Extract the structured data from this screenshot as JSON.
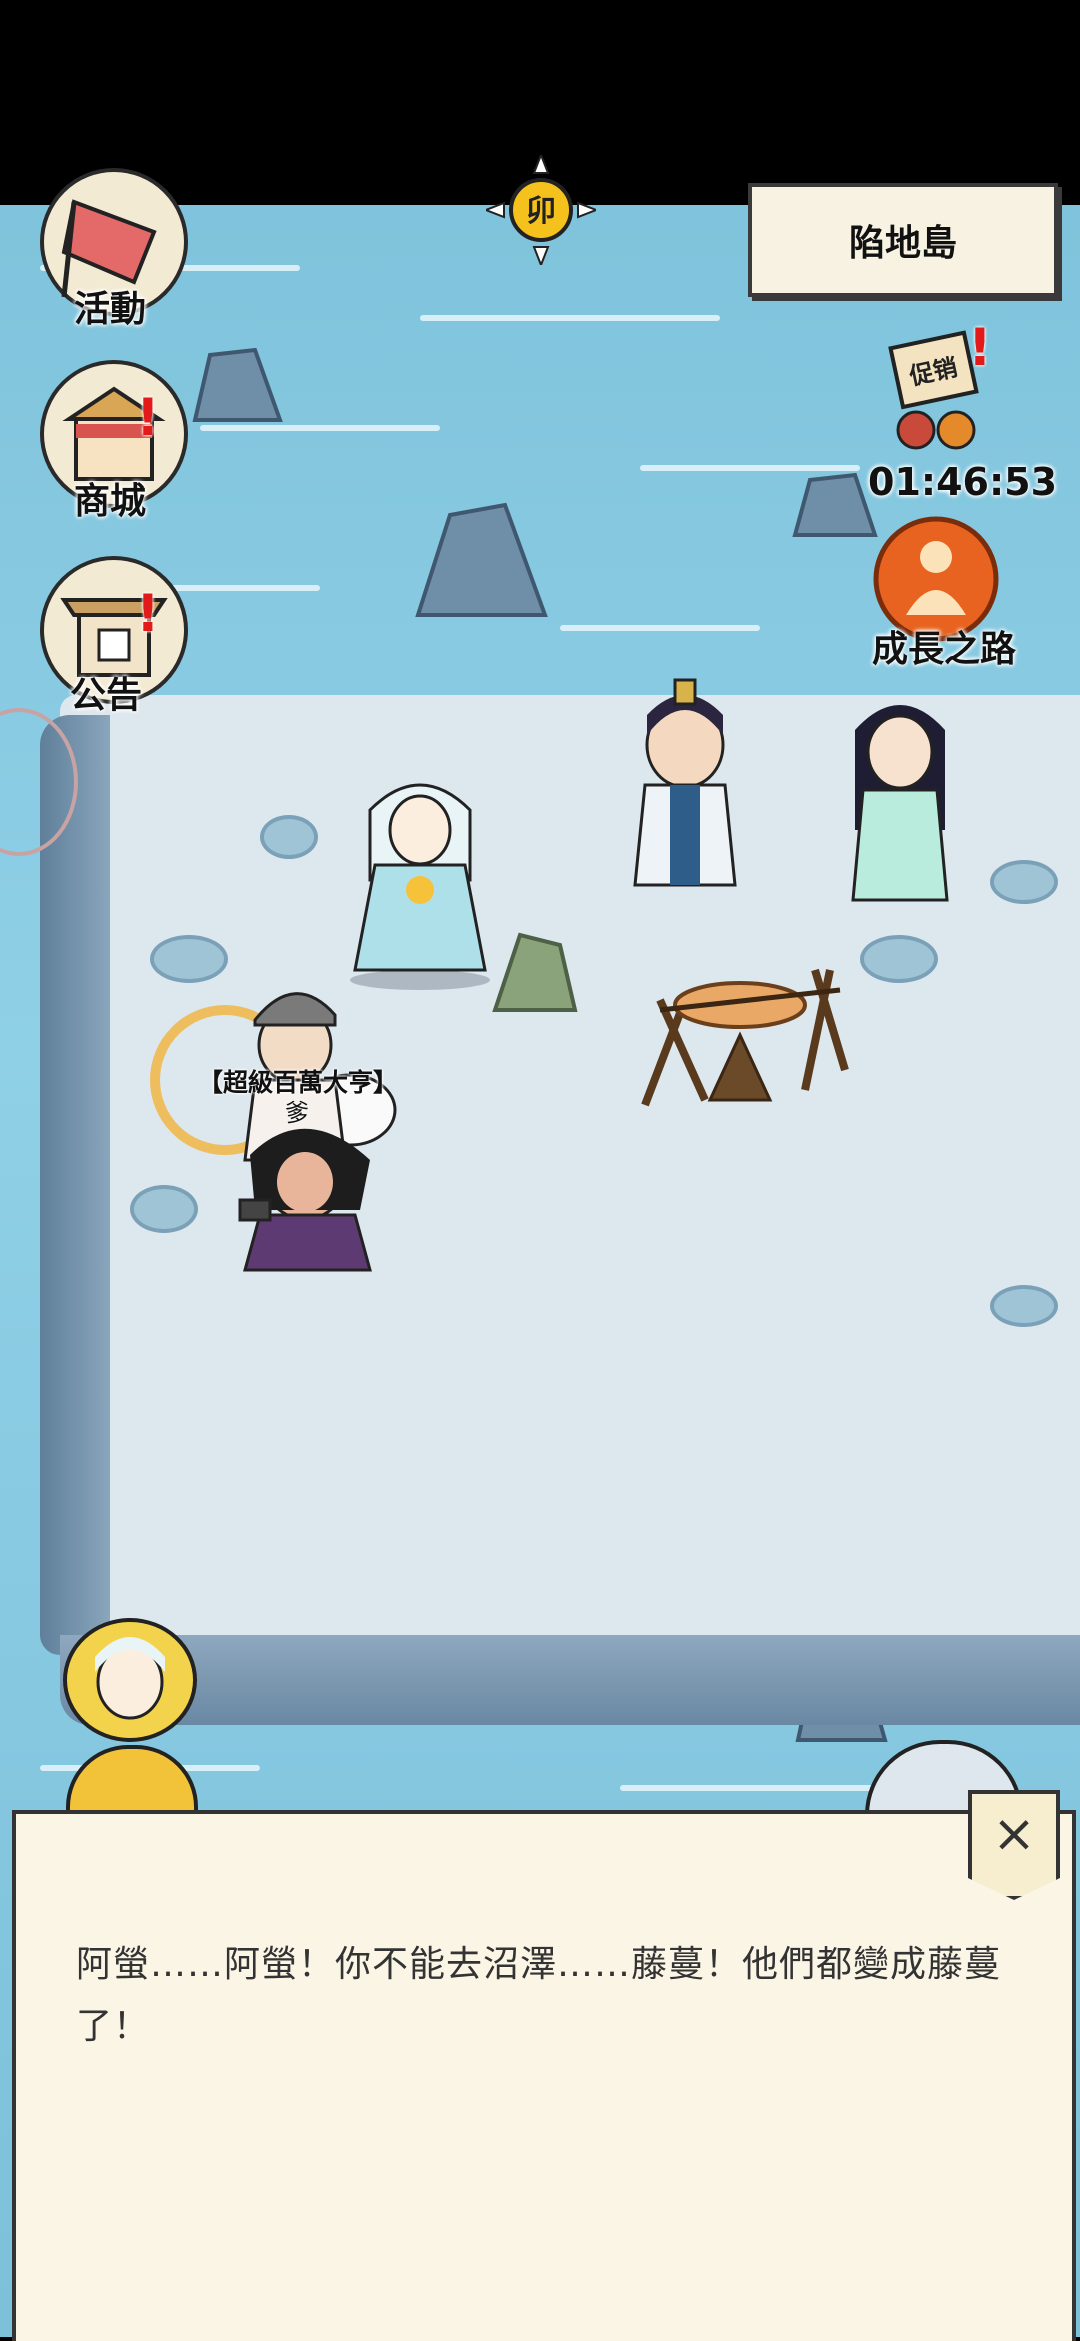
{
  "hud": {
    "activity_label": "活動",
    "shop_label": "商城",
    "notice_label": "公告",
    "location": "陷地島",
    "promo_sign": "促销",
    "promo_timer": "01:46:53",
    "growth_label": "成長之路",
    "time_glyph": "卯"
  },
  "scene": {
    "player_title": "【超級百萬大亨】",
    "player_name": "爹"
  },
  "dialog": {
    "text": "阿螢……阿螢！你不能去沼澤……藤蔓！他們都變成藤蔓了！",
    "close_symbol": "×"
  },
  "colors": {
    "sea": "#8fd0e6",
    "island": "#dde7ee",
    "panel": "#fbf5e6",
    "alert": "#e21a1a"
  },
  "icons": [
    "flag-icon",
    "shop-icon",
    "notice-icon",
    "sun-time-icon",
    "promo-icon",
    "growth-icon",
    "avatar-icon",
    "gold-coin-icon",
    "sprint-icon",
    "close-icon"
  ]
}
